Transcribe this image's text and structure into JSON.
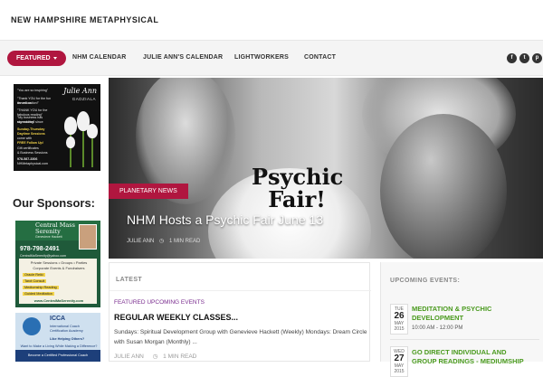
{
  "site": {
    "title": "NEW HAMPSHIRE METAPHYSICAL"
  },
  "nav": {
    "featured_label": "FEATURED",
    "items": [
      "NHM CALENDAR",
      "JULIE ANN'S CALENDAR",
      "LIGHTWORKERS",
      "CONTACT"
    ],
    "social_icons": [
      "facebook-icon",
      "twitter-icon",
      "pinterest-icon"
    ],
    "social_glyphs": [
      "f",
      "t",
      "p"
    ]
  },
  "sidebar": {
    "ad1": {
      "signature": "Julie Ann",
      "signature_sub": "GADZIALA",
      "quote_lines": [
        "\"You are so inspiring\"",
        "\"Thank YOU for the fun as well as",
        "the education!\"",
        "\"THANK YOU for the fabulous reading\"",
        "\"My business has skyrocketed since",
        "my reading\""
      ],
      "promo_lines": [
        "Sunday-Thursday",
        "Daytime Sessions",
        "come with",
        "FREE Follow Up!",
        "Gift certificates",
        "& Business Sessions"
      ],
      "phone": "978-587-3306",
      "email": "NHMetaphysical.com"
    },
    "sponsors_title": "Our Sponsors:",
    "ad2": {
      "name_line1": "Central Mass",
      "name_line2": "Serenity",
      "sub": "Genevieve Hackett",
      "phone": "978-798-2491",
      "email": "CentralMaSerenity@yahoo.com",
      "body_lines": [
        "Private Sessions • Groups • Parties",
        "Corporate Events & Fundraisers"
      ],
      "list": [
        "Oracle Reiki",
        "Tarot Consult",
        "Mediumship Reading",
        "Guided Meditation"
      ],
      "url": "www.CentralMaSerenity.com"
    },
    "ad3": {
      "badge": "ICCA",
      "lines": [
        "International Coach",
        "Certification Academy",
        "Like Helping Others?"
      ],
      "band_line1": "Want to Make a Living While Making a Difference?",
      "band_line2": "Become a Certified Professional Coach"
    }
  },
  "hero": {
    "poster_text_line1": "Psychic",
    "poster_text_line2": "Fair!",
    "category": "PLANETARY NEWS",
    "title": "NHM Hosts a Psychic Fair June 13",
    "author": "JULIE ANN",
    "read_time": "1 MIN READ"
  },
  "latest": {
    "label": "LATEST",
    "categories": "FEATURED UPCOMING EVENTS",
    "title": "REGULAR WEEKLY CLASSES...",
    "excerpt": "Sundays: Spiritual Development Group with Genevieve Hackett (Weekly) Mondays: Dream Circle with Susan Morgan (Monthly) ...",
    "author": "JULIE ANN",
    "read_time": "1 MIN READ"
  },
  "events": {
    "label": "UPCOMING EVENTS:",
    "items": [
      {
        "day": "TUE",
        "num": "26",
        "mon": "MAY",
        "year": "2015",
        "title_line1": "MEDITATION & PSYCHIC",
        "title_line2": "DEVELOPMENT",
        "time": "10:00 AM - 12:00 PM"
      },
      {
        "day": "WED",
        "num": "27",
        "mon": "MAY",
        "year": "2015",
        "title_line1": "GO DIRECT INDIVIDUAL AND",
        "title_line2": "GROUP READINGS - MEDIUMSHIP"
      }
    ]
  },
  "colors": {
    "accent": "#b0163f",
    "event_green": "#4a9a1e",
    "category_purple": "#7a2d8f"
  }
}
